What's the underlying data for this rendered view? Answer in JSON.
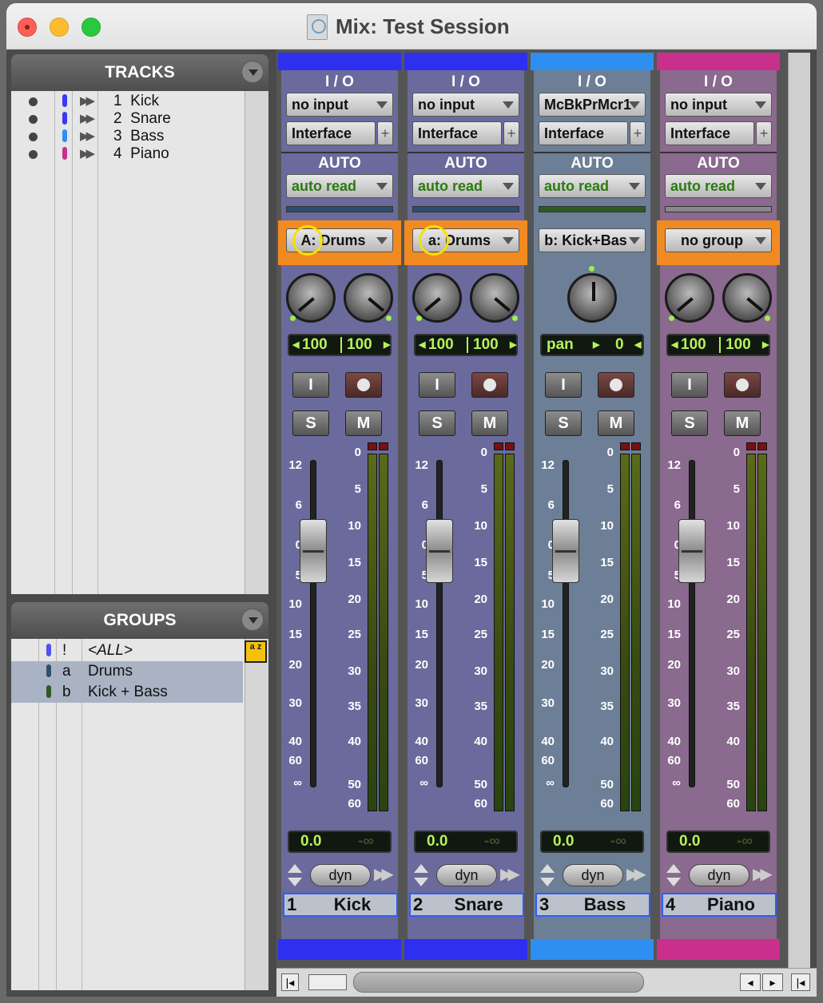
{
  "window": {
    "title": "Mix: Test Session"
  },
  "tracks_panel": {
    "title": "TRACKS",
    "items": [
      {
        "num": "1",
        "name": "Kick",
        "color": "#3a3af0"
      },
      {
        "num": "2",
        "name": "Snare",
        "color": "#3a3af0"
      },
      {
        "num": "3",
        "name": "Bass",
        "color": "#2f8ff0"
      },
      {
        "num": "4",
        "name": "Piano",
        "color": "#c8308c"
      }
    ]
  },
  "groups_panel": {
    "title": "GROUPS",
    "items": [
      {
        "id": "!",
        "name": "<ALL>",
        "color": "#5050f0",
        "selected": false
      },
      {
        "id": "a",
        "name": "Drums",
        "color": "#2d4f6c",
        "selected": true
      },
      {
        "id": "b",
        "name": "Kick + Bass",
        "color": "#2f5a22",
        "selected": true
      }
    ],
    "sort_badge": "a z"
  },
  "strips": [
    {
      "num": "1",
      "name": "Kick",
      "color": "#2f2ff0",
      "io_label": "I / O",
      "input": "no input",
      "output": "Interface",
      "auto_label": "AUTO",
      "auto_mode": "auto read",
      "group": "A: Drums",
      "group_hl": true,
      "pan_left": "100",
      "pan_right": "100",
      "input_btn": "I",
      "solo": "S",
      "mute": "M",
      "volume": "0.0",
      "peak": "-∞",
      "dyn": "dyn"
    },
    {
      "num": "2",
      "name": "Snare",
      "color": "#2f2ff0",
      "io_label": "I / O",
      "input": "no input",
      "output": "Interface",
      "auto_label": "AUTO",
      "auto_mode": "auto read",
      "group": "a: Drums",
      "group_hl": true,
      "pan_left": "100",
      "pan_right": "100",
      "input_btn": "I",
      "solo": "S",
      "mute": "M",
      "volume": "0.0",
      "peak": "-∞",
      "dyn": "dyn"
    },
    {
      "num": "3",
      "name": "Bass",
      "color": "#2f8ff0",
      "io_label": "I / O",
      "input": "McBkPrMcr1",
      "output": "Interface",
      "auto_label": "AUTO",
      "auto_mode": "auto read",
      "group": "b: Kick+Bas",
      "group_hl": false,
      "pan_label": "pan",
      "pan_value": "0",
      "input_btn": "I",
      "solo": "S",
      "mute": "M",
      "volume": "0.0",
      "peak": "-∞",
      "dyn": "dyn"
    },
    {
      "num": "4",
      "name": "Piano",
      "color": "#c8308c",
      "io_label": "I / O",
      "input": "no input",
      "output": "Interface",
      "auto_label": "AUTO",
      "auto_mode": "auto read",
      "group": "no group",
      "group_hl": true,
      "pan_left": "100",
      "pan_right": "100",
      "input_btn": "I",
      "solo": "S",
      "mute": "M",
      "volume": "0.0",
      "peak": "-∞",
      "dyn": "dyn"
    }
  ],
  "fader_scale": [
    "12",
    "6",
    "0",
    "5",
    "10",
    "15",
    "20",
    "30",
    "40",
    "60",
    "∞"
  ],
  "meter_scale": [
    "0",
    "5",
    "10",
    "15",
    "20",
    "25",
    "30",
    "35",
    "40",
    "50",
    "60"
  ],
  "colors": {
    "strip_blue_bg": "#6a6a9c",
    "strip_bass_bg": "#6d7f96",
    "strip_piano_bg": "#8a6a8e",
    "group_highlight": "#f28a22",
    "lcd_text": "#b6f25a"
  }
}
